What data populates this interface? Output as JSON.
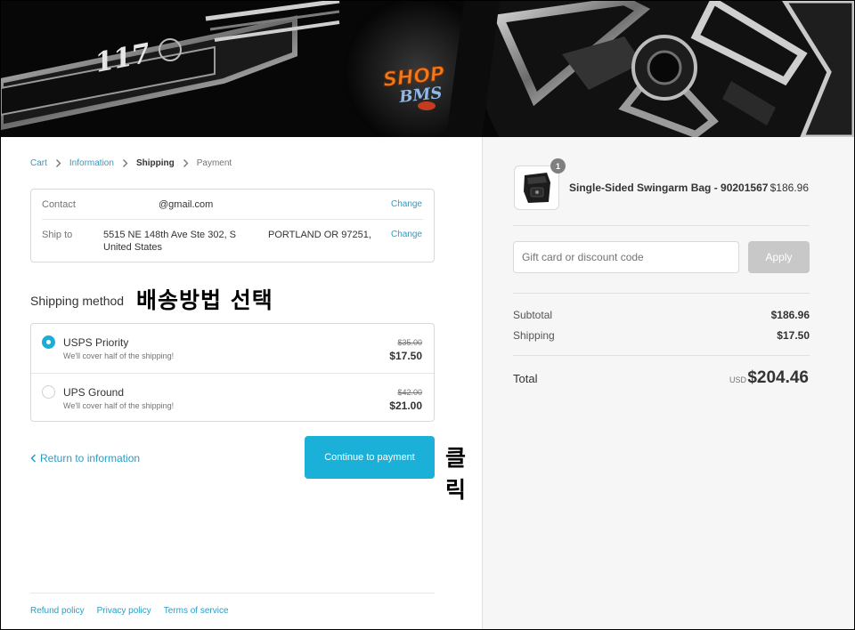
{
  "banner": {
    "badge_text": "117",
    "logo_text": "SHOP",
    "logo_sub": "BMS"
  },
  "breadcrumb": {
    "items": [
      {
        "label": "Cart",
        "state": "link"
      },
      {
        "label": "Information",
        "state": "link"
      },
      {
        "label": "Shipping",
        "state": "current"
      },
      {
        "label": "Payment",
        "state": "upcoming"
      }
    ]
  },
  "review": {
    "contact_label": "Contact",
    "contact_value": "@gmail.com",
    "ship_label": "Ship to",
    "ship_line1": "5515 NE 148th Ave Ste 302, S",
    "ship_line2": "United States",
    "ship_city": "PORTLAND OR 97251,",
    "change_label": "Change"
  },
  "shipping": {
    "title": "Shipping method",
    "annotation": "배송방법 선택",
    "methods": [
      {
        "name": "USPS Priority",
        "description": "We'll cover half of the shipping!",
        "original_price": "$35.00",
        "price": "$17.50",
        "selected": true
      },
      {
        "name": "UPS Ground",
        "description": "We'll cover half of the shipping!",
        "original_price": "$42.00",
        "price": "$21.00",
        "selected": false
      }
    ]
  },
  "actions": {
    "return_label": "Return to information",
    "continue_label": "Continue to payment",
    "click_annotation": "클릭"
  },
  "footer": {
    "links": [
      "Refund policy",
      "Privacy policy",
      "Terms of service"
    ]
  },
  "summary": {
    "product": {
      "name": "Single-Sided Swingarm Bag - 90201567",
      "price": "$186.96",
      "quantity": "1"
    },
    "discount_placeholder": "Gift card or discount code",
    "apply_label": "Apply",
    "subtotal_label": "Subtotal",
    "subtotal_value": "$186.96",
    "shipping_label": "Shipping",
    "shipping_value": "$17.50",
    "total_label": "Total",
    "total_currency": "USD",
    "total_value": "$204.46"
  },
  "colors": {
    "accent": "#1ab0d8",
    "link": "#2a9dc6",
    "sidebar_bg": "#f6f6f6"
  }
}
